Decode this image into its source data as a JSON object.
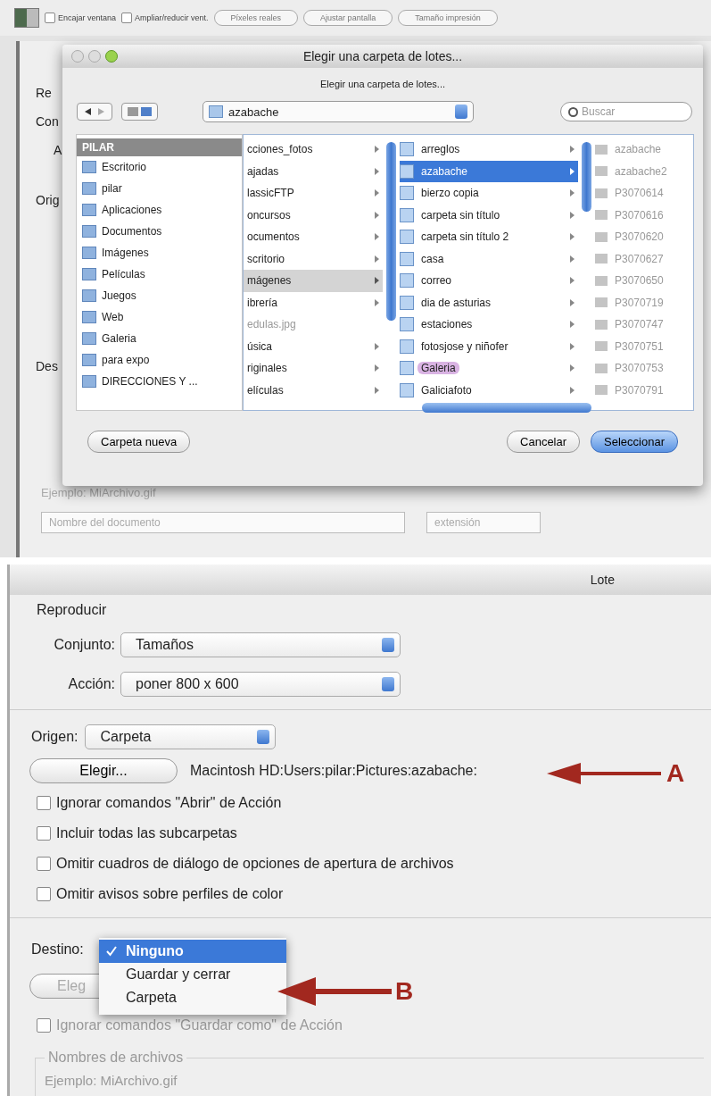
{
  "toolbar": {
    "checkboxes": [
      {
        "label": "Encajar ventana",
        "checked": false
      },
      {
        "label": "Ampliar/reducir vent.",
        "checked": false
      }
    ],
    "buttons": [
      "Píxeles reales",
      "Ajustar pantalla",
      "Tamaño impresión"
    ]
  },
  "background": {
    "fragments": [
      "Re",
      "Con",
      "A",
      "Orig",
      "Des"
    ],
    "example": "Ejemplo: MiArchivo.gif",
    "name_field": "Nombre del documento",
    "ext_field": "extensión"
  },
  "dialog": {
    "title": "Elegir una carpeta de lotes...",
    "prompt": "Elegir una carpeta de lotes...",
    "location": "azabache",
    "search_placeholder": "Buscar",
    "sidebar": [
      {
        "label": "PILAR",
        "kind": "header",
        "selected": true
      },
      {
        "label": "Escritorio",
        "kind": "place",
        "selected": false
      },
      {
        "label": "pilar",
        "kind": "place",
        "selected": false
      },
      {
        "label": "Aplicaciones",
        "kind": "place",
        "selected": false
      },
      {
        "label": "Documentos",
        "kind": "place",
        "selected": false
      },
      {
        "label": "Imágenes",
        "kind": "place",
        "selected": false
      },
      {
        "label": "Películas",
        "kind": "place",
        "selected": false
      },
      {
        "label": "Juegos",
        "kind": "place",
        "selected": false
      },
      {
        "label": "Web",
        "kind": "place",
        "selected": false
      },
      {
        "label": "Galeria",
        "kind": "place",
        "selected": false
      },
      {
        "label": "para expo",
        "kind": "place",
        "selected": false
      },
      {
        "label": "DIRECCIONES Y ...",
        "kind": "place",
        "selected": false
      }
    ],
    "columns": [
      [
        {
          "name": "cciones_fotos",
          "kind": "folder",
          "selected": false
        },
        {
          "name": "ajadas",
          "kind": "folder",
          "selected": false
        },
        {
          "name": "lassicFTP",
          "kind": "folder",
          "selected": false
        },
        {
          "name": "oncursos",
          "kind": "folder",
          "selected": false
        },
        {
          "name": "ocumentos",
          "kind": "folder",
          "selected": false
        },
        {
          "name": "scritorio",
          "kind": "folder",
          "selected": false
        },
        {
          "name": "mágenes",
          "kind": "folder",
          "selected": true
        },
        {
          "name": "ibrería",
          "kind": "folder",
          "selected": false
        },
        {
          "name": "edulas.jpg",
          "kind": "file",
          "selected": false
        },
        {
          "name": "úsica",
          "kind": "folder",
          "selected": false
        },
        {
          "name": "riginales",
          "kind": "folder",
          "selected": false
        },
        {
          "name": "elículas",
          "kind": "folder",
          "selected": false
        }
      ],
      [
        {
          "name": "arreglos",
          "kind": "folder",
          "selected": false
        },
        {
          "name": "azabache",
          "kind": "folder",
          "selected": true
        },
        {
          "name": "bierzo copia",
          "kind": "folder",
          "selected": false
        },
        {
          "name": "carpeta sin título",
          "kind": "folder",
          "selected": false
        },
        {
          "name": "carpeta sin título 2",
          "kind": "folder",
          "selected": false
        },
        {
          "name": "casa",
          "kind": "folder",
          "selected": false
        },
        {
          "name": "correo",
          "kind": "folder",
          "selected": false
        },
        {
          "name": "dia de asturias",
          "kind": "folder",
          "selected": false
        },
        {
          "name": "estaciones",
          "kind": "folder",
          "selected": false
        },
        {
          "name": "fotosjose y niñofer",
          "kind": "folder",
          "selected": false
        },
        {
          "name": "Galeria",
          "kind": "folder",
          "selected": false,
          "color": "#d9b3e3"
        },
        {
          "name": "Galiciafoto",
          "kind": "folder",
          "selected": false
        }
      ],
      [
        {
          "name": "azabache",
          "kind": "file",
          "selected": false
        },
        {
          "name": "azabache2",
          "kind": "file",
          "selected": false
        },
        {
          "name": "P3070614",
          "kind": "file",
          "selected": false
        },
        {
          "name": "P3070616",
          "kind": "file",
          "selected": false
        },
        {
          "name": "P3070620",
          "kind": "file",
          "selected": false
        },
        {
          "name": "P3070627",
          "kind": "file",
          "selected": false
        },
        {
          "name": "P3070650",
          "kind": "file",
          "selected": false
        },
        {
          "name": "P3070719",
          "kind": "file",
          "selected": false
        },
        {
          "name": "P3070747",
          "kind": "file",
          "selected": false
        },
        {
          "name": "P3070751",
          "kind": "file",
          "selected": false
        },
        {
          "name": "P3070753",
          "kind": "file",
          "selected": false
        },
        {
          "name": "P3070791",
          "kind": "file",
          "selected": false
        }
      ]
    ],
    "buttons": {
      "new_folder": "Carpeta nueva",
      "cancel": "Cancelar",
      "choose": "Seleccionar"
    }
  },
  "lote": {
    "title": "Lote",
    "play": {
      "legend": "Reproducir",
      "set_label": "Conjunto:",
      "set_value": "Tamaños",
      "action_label": "Acción:",
      "action_value": "poner 800 x 600"
    },
    "source": {
      "label": "Origen:",
      "value": "Carpeta",
      "choose": "Elegir...",
      "path": "Macintosh HD:Users:pilar:Pictures:azabache:",
      "options": [
        {
          "label": "Ignorar comandos \"Abrir\" de Acción",
          "checked": false
        },
        {
          "label": "Incluir todas las subcarpetas",
          "checked": false
        },
        {
          "label": "Omitir cuadros de diálogo de opciones de apertura de archivos",
          "checked": false
        },
        {
          "label": "Omitir avisos sobre perfiles de color",
          "checked": false
        }
      ]
    },
    "destination": {
      "label": "Destino:",
      "menu": [
        {
          "label": "Ninguno",
          "selected": true
        },
        {
          "label": "Guardar y cerrar",
          "selected": false
        },
        {
          "label": "Carpeta",
          "selected": false
        }
      ],
      "choose": "Eleg",
      "option": {
        "label": "Ignorar comandos \"Guardar como\" de Acción",
        "checked": false
      },
      "names_legend": "Nombres de archivos",
      "example": "Ejemplo: MiArchivo.gif"
    }
  },
  "annotations": [
    {
      "letter": "A"
    },
    {
      "letter": "B"
    }
  ]
}
